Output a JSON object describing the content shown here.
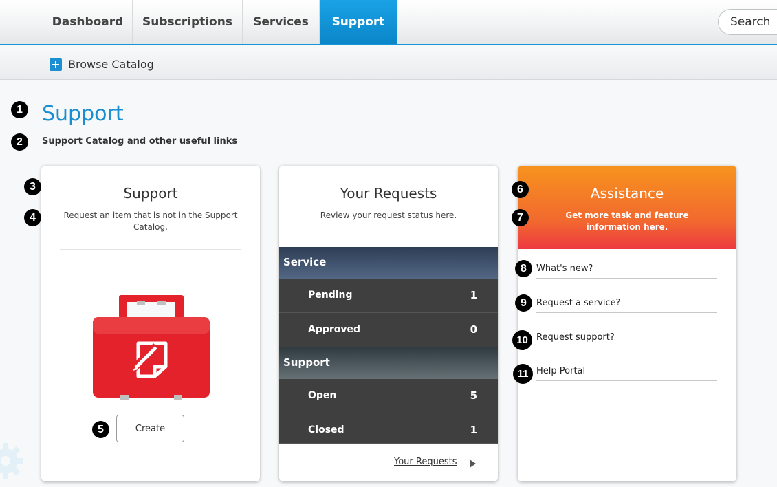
{
  "nav": {
    "tabs": [
      {
        "label": "Dashboard",
        "active": false
      },
      {
        "label": "Subscriptions",
        "active": false
      },
      {
        "label": "Services",
        "active": false
      },
      {
        "label": "Support",
        "active": true
      }
    ],
    "search_label": "Search"
  },
  "subnav": {
    "browse_label": "Browse Catalog",
    "browse_icon": "plus-icon"
  },
  "page": {
    "title": "Support",
    "subtitle": "Support Catalog and other useful links"
  },
  "markers": [
    "1",
    "2",
    "3",
    "4",
    "5",
    "6",
    "7",
    "8",
    "9",
    "10",
    "11"
  ],
  "support_card": {
    "title": "Support",
    "description": "Request an item that is not in the Support Catalog.",
    "icon": "red-toolbox-icon",
    "create_label": "Create"
  },
  "requests_card": {
    "title": "Your Requests",
    "description": "Review your request status here.",
    "sections": [
      {
        "name": "Service",
        "rows": [
          {
            "label": "Pending",
            "count": "1"
          },
          {
            "label": "Approved",
            "count": "0"
          }
        ]
      },
      {
        "name": "Support",
        "rows": [
          {
            "label": "Open",
            "count": "5"
          },
          {
            "label": "Closed",
            "count": "1"
          }
        ]
      }
    ],
    "link_label": "Your Requests"
  },
  "assistance_card": {
    "title": "Assistance",
    "description": "Get more task and feature information here.",
    "links": [
      "What's new?",
      "Request a service?",
      "Request support?",
      "Help Portal"
    ]
  },
  "colors": {
    "accent_blue": "#1796d6",
    "assist_orange": "#f7931e",
    "assist_red": "#ed3a41",
    "toolbox_red": "#e4222b",
    "request_dark": "#3f3f3f"
  }
}
